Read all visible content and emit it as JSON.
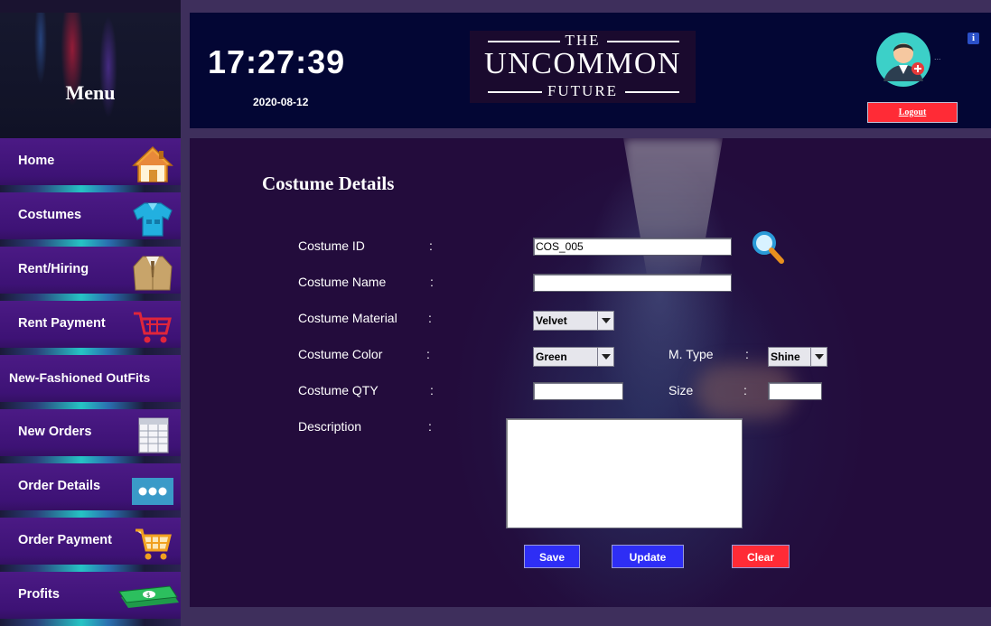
{
  "sidebar": {
    "title": "Menu",
    "items": [
      {
        "label": "Home",
        "icon": "house-icon"
      },
      {
        "label": "Costumes",
        "icon": "shirt-icon"
      },
      {
        "label": "Rent/Hiring",
        "icon": "suit-jacket-icon"
      },
      {
        "label": "Rent Payment",
        "icon": "shopping-cart-icon"
      },
      {
        "label": "New-Fashioned OutFits",
        "icon": ""
      },
      {
        "label": "New Orders",
        "icon": "spreadsheet-icon"
      },
      {
        "label": "Order Details",
        "icon": "more-dots-icon"
      },
      {
        "label": "Order Payment",
        "icon": "shopping-cart-icon"
      },
      {
        "label": "Profits",
        "icon": "money-stack-icon"
      }
    ]
  },
  "header": {
    "time": "17:27:39",
    "date": "2020-08-12",
    "logo": {
      "top": "THE",
      "main": "UNCOMMON",
      "bottom": "FUTURE"
    },
    "user_truncated": "...",
    "info_glyph": "i",
    "logout_label": "Logout"
  },
  "form": {
    "title": "Costume Details",
    "colon": ":",
    "labels": {
      "costume_id": "Costume  ID",
      "costume_name": "Costume  Name",
      "costume_material": "Costume  Material",
      "costume_color": "Costume Color",
      "costume_qty": "Costume QTY",
      "description": "Description",
      "m_type": "M. Type",
      "size": "Size"
    },
    "values": {
      "costume_id": "COS_005",
      "costume_name": "",
      "costume_material": "Velvet",
      "costume_color": "Green",
      "m_type": "Shine",
      "costume_qty": "",
      "size": "",
      "description": ""
    },
    "buttons": {
      "save": "Save",
      "update": "Update",
      "clear": "Clear"
    }
  },
  "colors": {
    "sidebar_item": "#4b1a85",
    "header_bg": "#030634",
    "logout": "#ff2b36",
    "save": "#2e2ef5",
    "update": "#2e2ef5",
    "clear": "#ff2b36"
  }
}
